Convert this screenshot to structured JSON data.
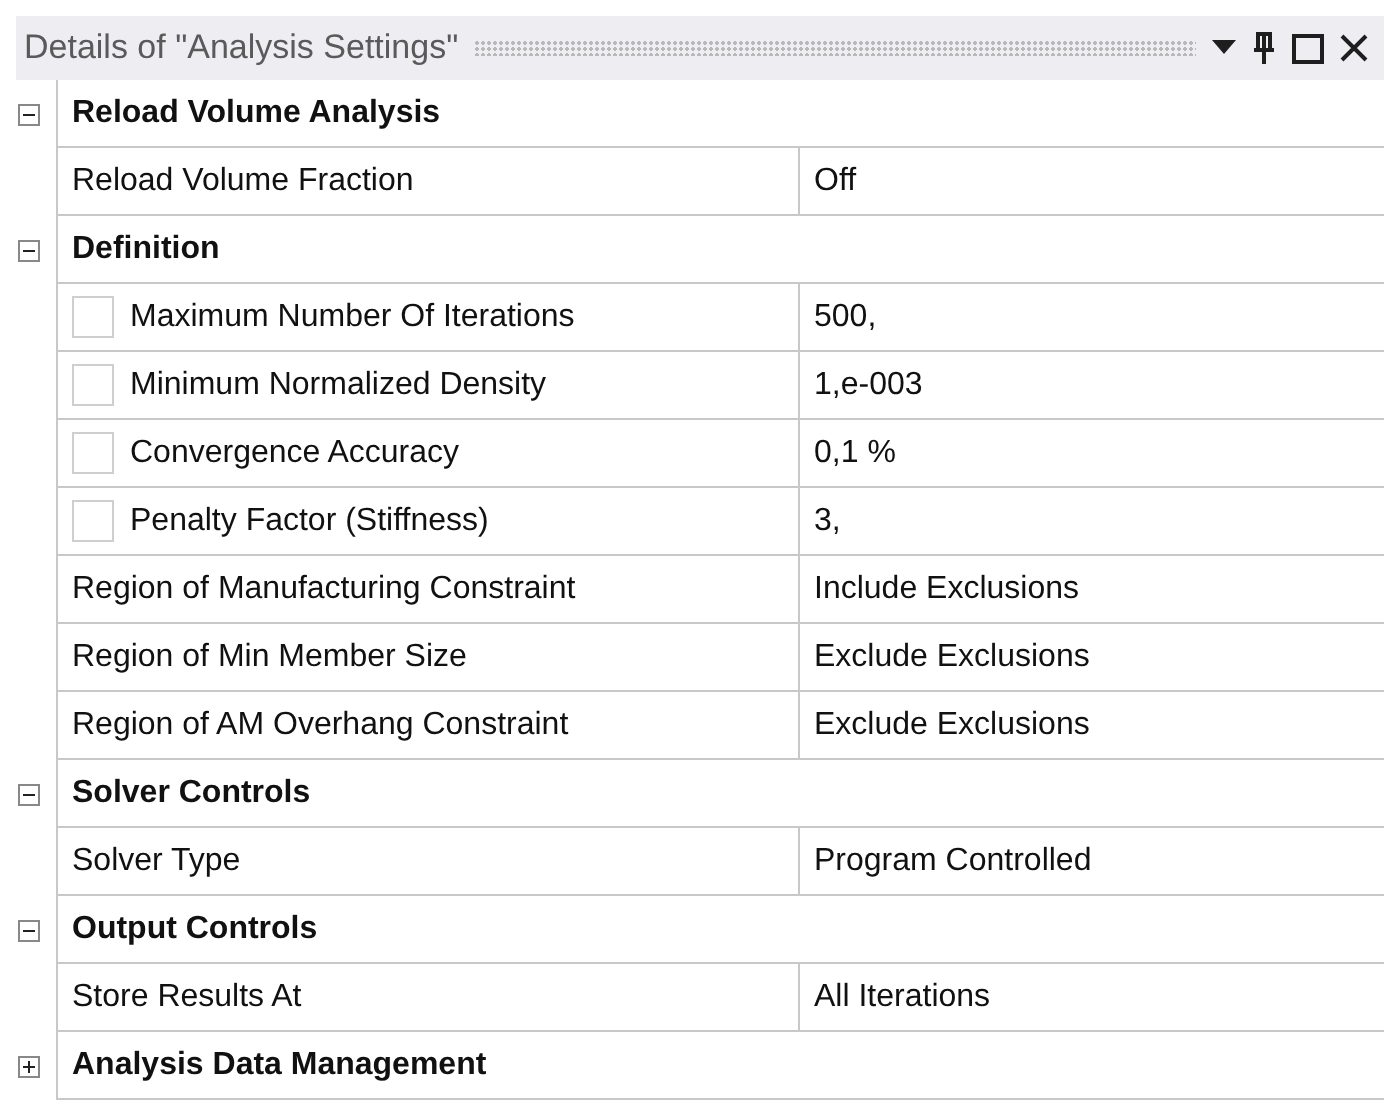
{
  "panel": {
    "title": "Details of \"Analysis Settings\""
  },
  "groups": [
    {
      "title": "Reload Volume Analysis",
      "expanded": true,
      "rows": [
        {
          "kind": "plain",
          "label": "Reload Volume Fraction",
          "value": "Off"
        }
      ]
    },
    {
      "title": "Definition",
      "expanded": true,
      "rows": [
        {
          "kind": "checkbox",
          "checked": false,
          "label": "Maximum Number Of Iterations",
          "value": "500,"
        },
        {
          "kind": "checkbox",
          "checked": false,
          "label": "Minimum Normalized Density",
          "value": "1,e-003"
        },
        {
          "kind": "checkbox",
          "checked": false,
          "label": "Convergence Accuracy",
          "value": "0,1 %"
        },
        {
          "kind": "checkbox",
          "checked": false,
          "label": "Penalty Factor (Stiffness)",
          "value": "3,"
        },
        {
          "kind": "plain",
          "label": "Region of Manufacturing Constraint",
          "value": "Include Exclusions"
        },
        {
          "kind": "plain",
          "label": "Region of Min Member Size",
          "value": "Exclude Exclusions"
        },
        {
          "kind": "plain",
          "label": "Region of AM Overhang Constraint",
          "value": "Exclude Exclusions"
        }
      ]
    },
    {
      "title": "Solver Controls",
      "expanded": true,
      "rows": [
        {
          "kind": "plain",
          "label": "Solver Type",
          "value": "Program Controlled"
        }
      ]
    },
    {
      "title": "Output Controls",
      "expanded": true,
      "rows": [
        {
          "kind": "plain",
          "label": "Store Results At",
          "value": "All Iterations"
        }
      ]
    },
    {
      "title": "Analysis Data Management",
      "expanded": false
    }
  ]
}
